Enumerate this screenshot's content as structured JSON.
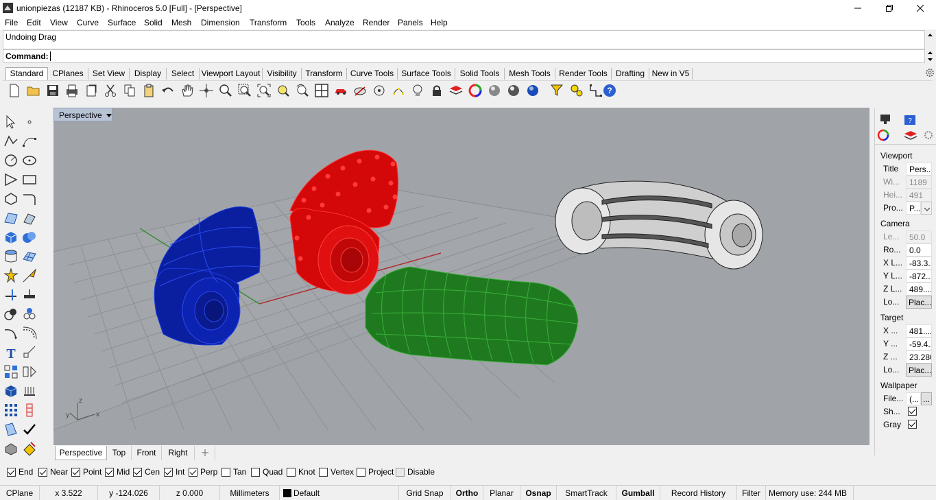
{
  "window": {
    "title": "unionpiezas (12187 KB) - Rhinoceros 5.0 [Full] - [Perspective]"
  },
  "menu": [
    "File",
    "Edit",
    "View",
    "Curve",
    "Surface",
    "Solid",
    "Mesh",
    "Dimension",
    "Transform",
    "Tools",
    "Analyze",
    "Render",
    "Panels",
    "Help"
  ],
  "command": {
    "history": "Undoing Drag",
    "label": "Command:"
  },
  "toolbar_tabs": [
    "Standard",
    "CPlanes",
    "Set View",
    "Display",
    "Select",
    "Viewport Layout",
    "Visibility",
    "Transform",
    "Curve Tools",
    "Surface Tools",
    "Solid Tools",
    "Mesh Tools",
    "Render Tools",
    "Drafting",
    "New in V5"
  ],
  "viewport": {
    "title": "Perspective",
    "axes": {
      "z": "z",
      "y": "y",
      "x": "x"
    }
  },
  "viewport_tabs": [
    "Perspective",
    "Top",
    "Front",
    "Right"
  ],
  "osnaps": [
    {
      "label": "End",
      "checked": true
    },
    {
      "label": "Near",
      "checked": true
    },
    {
      "label": "Point",
      "checked": true
    },
    {
      "label": "Mid",
      "checked": true
    },
    {
      "label": "Cen",
      "checked": true
    },
    {
      "label": "Int",
      "checked": true
    },
    {
      "label": "Perp",
      "checked": true
    },
    {
      "label": "Tan",
      "checked": false
    },
    {
      "label": "Quad",
      "checked": false
    },
    {
      "label": "Knot",
      "checked": false
    },
    {
      "label": "Vertex",
      "checked": false
    },
    {
      "label": "Project",
      "checked": false
    },
    {
      "label": "Disable",
      "checked": false
    }
  ],
  "status": {
    "cplane": "CPlane",
    "x": "x 3.522",
    "y": "y -124.026",
    "z": "z 0.000",
    "units": "Millimeters",
    "layer": "Default",
    "grid_snap": "Grid Snap",
    "ortho": "Ortho",
    "planar": "Planar",
    "osnap": "Osnap",
    "smarttrack": "SmartTrack",
    "gumball": "Gumball",
    "record_history": "Record History",
    "filter": "Filter",
    "memory": "Memory use: 244 MB"
  },
  "properties": {
    "viewport_header": "Viewport",
    "viewport_rows": [
      {
        "key": "Title",
        "value": "Pers...",
        "dim": false
      },
      {
        "key": "Wi...",
        "value": "1189",
        "dim": true
      },
      {
        "key": "Hei...",
        "value": "491",
        "dim": true
      },
      {
        "key": "Pro...",
        "value": "P...",
        "dim": false
      }
    ],
    "camera_header": "Camera",
    "camera_rows": [
      {
        "key": "Le...",
        "value": "50.0",
        "dim": true
      },
      {
        "key": "Ro...",
        "value": "0.0",
        "dim": false
      },
      {
        "key": "X L...",
        "value": "-83.3...",
        "dim": false
      },
      {
        "key": "Y L...",
        "value": "-872....",
        "dim": false
      },
      {
        "key": "Z L...",
        "value": "489....",
        "dim": false
      },
      {
        "key": "Lo...",
        "value": "Plac...",
        "dim": false
      }
    ],
    "target_header": "Target",
    "target_rows": [
      {
        "key": "X ...",
        "value": "481....",
        "dim": false
      },
      {
        "key": "Y ...",
        "value": "-59.4...",
        "dim": false
      },
      {
        "key": "Z ...",
        "value": "23.280",
        "dim": false
      },
      {
        "key": "Lo...",
        "value": "Plac...",
        "dim": false
      }
    ],
    "wallpaper_header": "Wallpaper",
    "wallpaper_rows": [
      {
        "key": "File...",
        "value": "(...",
        "dim": false
      },
      {
        "key": "Sh...",
        "value": "",
        "dim": false
      },
      {
        "key": "Gray",
        "value": "",
        "dim": false
      }
    ],
    "browse_btn": "..."
  },
  "colors": {
    "blue_part": "#0a1fa0",
    "red_part": "#e01010",
    "green_part": "#2a8a2a",
    "viewport_bg": "#a0a4a8",
    "grid": "#8e9296"
  }
}
